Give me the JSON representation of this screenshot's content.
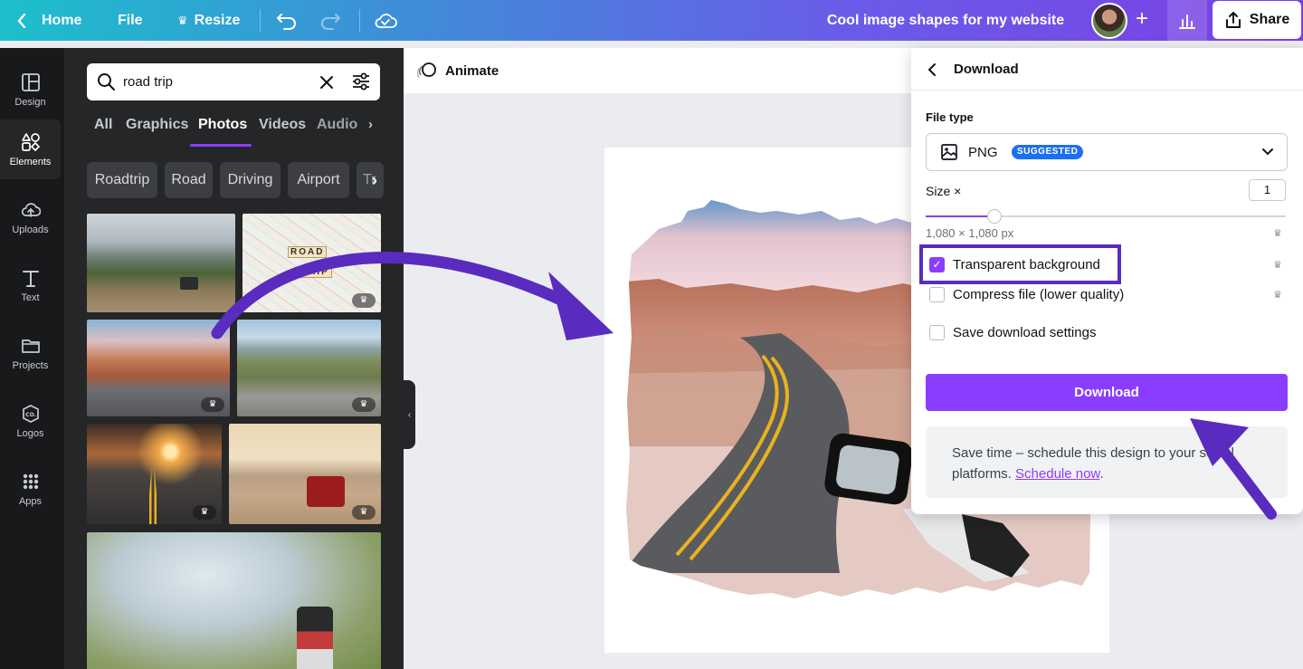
{
  "topbar": {
    "home_label": "Home",
    "file_label": "File",
    "resize_label": "Resize",
    "doc_title": "Cool image shapes for my website",
    "share_label": "Share"
  },
  "rail": {
    "items": [
      {
        "label": "Design",
        "icon": "layout-icon"
      },
      {
        "label": "Elements",
        "icon": "shapes-icon"
      },
      {
        "label": "Uploads",
        "icon": "cloud-upload-icon"
      },
      {
        "label": "Text",
        "icon": "text-icon"
      },
      {
        "label": "Projects",
        "icon": "folder-icon"
      },
      {
        "label": "Logos",
        "icon": "logo-icon"
      },
      {
        "label": "Apps",
        "icon": "apps-grid-icon"
      }
    ],
    "active": "Elements"
  },
  "panel": {
    "search_value": "road trip",
    "tabs": [
      "All",
      "Graphics",
      "Photos",
      "Videos",
      "Audio"
    ],
    "active_tab": "Photos",
    "chips": [
      "Roadtrip",
      "Road",
      "Driving",
      "Airport",
      "Tr"
    ],
    "map_words": [
      "ROAD",
      "TRIP"
    ]
  },
  "canvas": {
    "animate_label": "Animate"
  },
  "download": {
    "title": "Download",
    "file_type_label": "File type",
    "file_type_value": "PNG",
    "suggested_badge": "SUGGESTED",
    "size_label": "Size ×",
    "size_value": "1",
    "size_fraction": 0.19,
    "dimensions": "1,080 × 1,080 px",
    "options": [
      {
        "label": "Transparent background",
        "checked": true
      },
      {
        "label": "Compress file (lower quality)",
        "checked": false
      },
      {
        "label": "Save download settings",
        "checked": false
      }
    ],
    "button_label": "Download",
    "promo_text": "Save time – schedule this design to your social platforms. ",
    "promo_link": "Schedule now",
    "promo_end": "."
  },
  "colors": {
    "accent": "#8b3dff",
    "annotation": "#5a2bbf",
    "badge": "#1d6ff2"
  }
}
